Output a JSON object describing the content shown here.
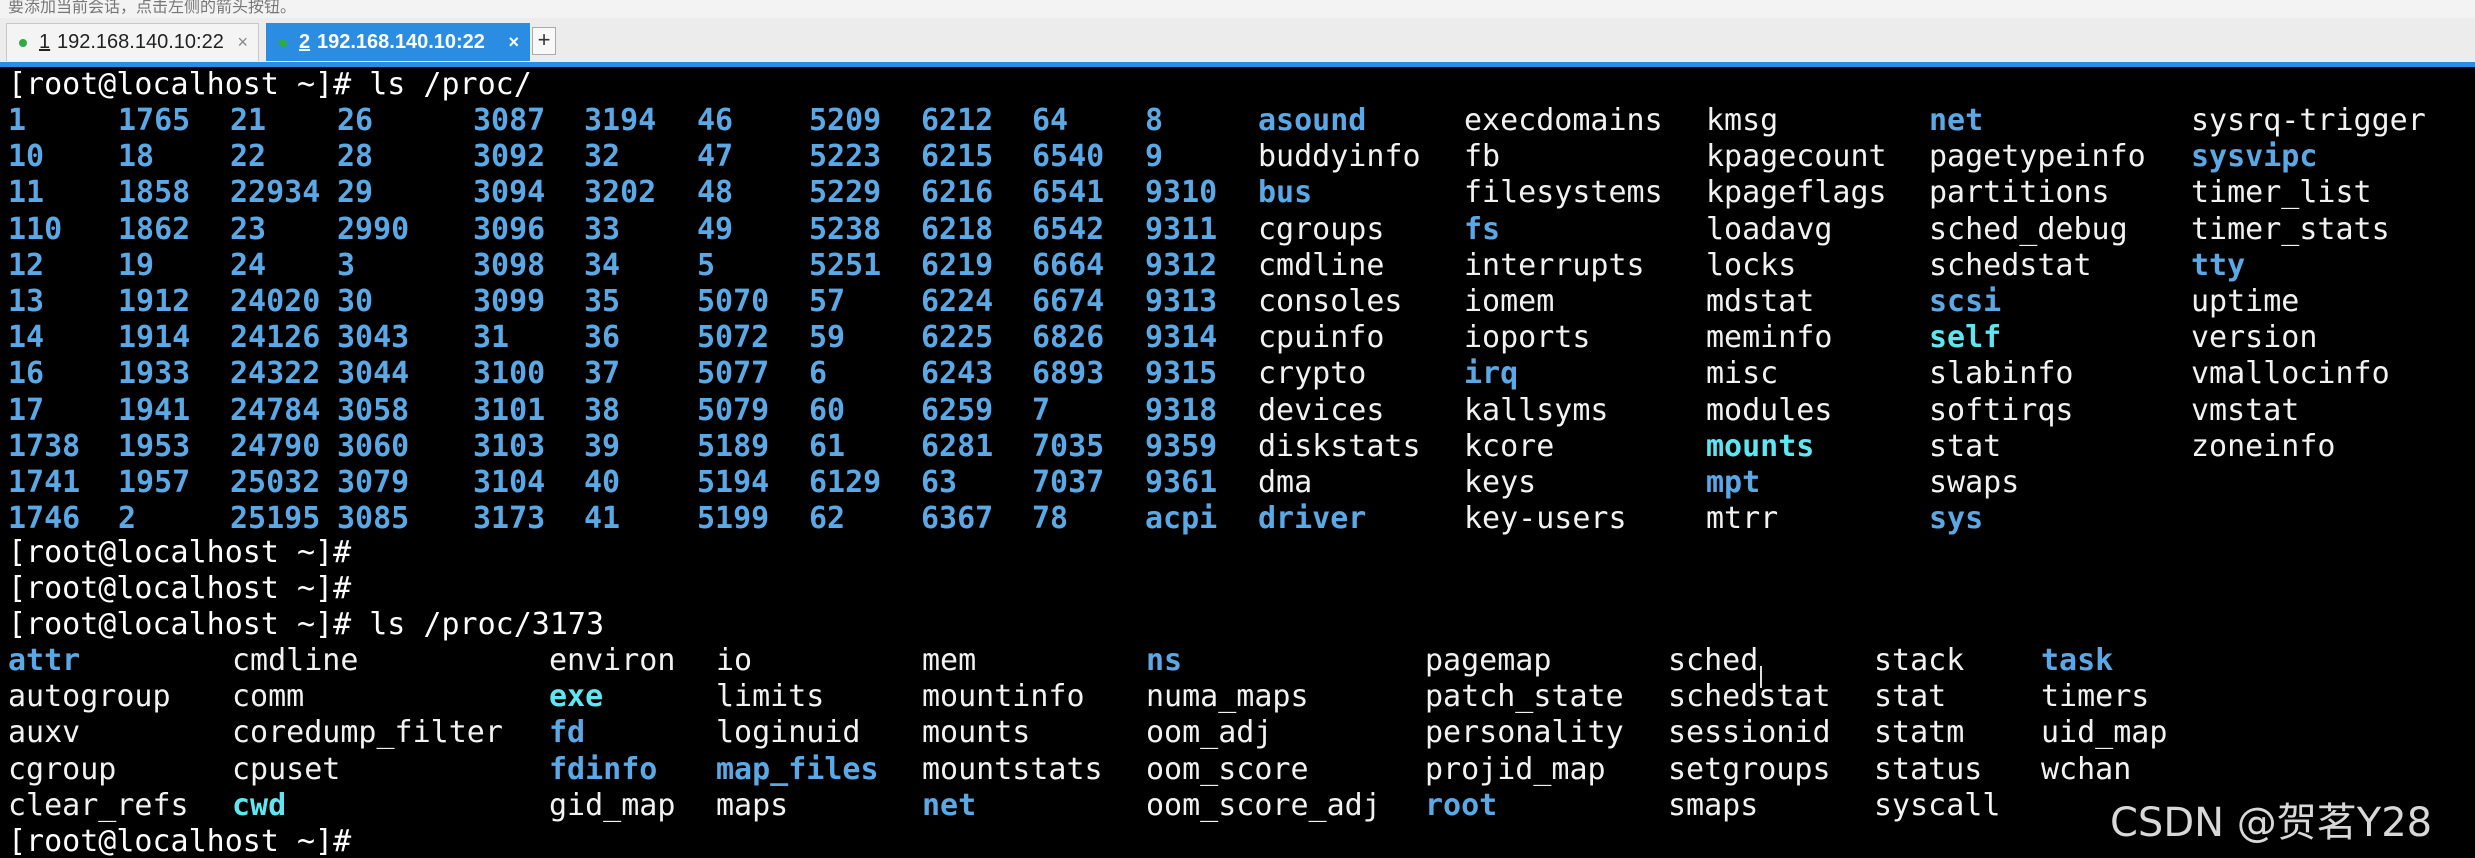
{
  "window": {
    "hint_text": "要添加当前会话，点击左侧的箭头按钮。",
    "tabs": [
      {
        "number": "1",
        "title": "192.168.140.10:22",
        "close": "×"
      },
      {
        "number": "2",
        "title": "192.168.140.10:22",
        "close": "×"
      }
    ],
    "add_tab": "+"
  },
  "terminal": {
    "prompt_lines": [
      "[root@localhost ~]# ls /proc/",
      "[root@localhost ~]#",
      "[root@localhost ~]#",
      "[root@localhost ~]# ls /proc/3173",
      "[root@localhost ~]#"
    ],
    "proc_listing": {
      "rows": [
        [
          "1",
          "1765",
          "21",
          "26",
          "3087",
          "3194",
          "46",
          "5209",
          "6212",
          "64",
          "8",
          "asound",
          "execdomains",
          "kmsg",
          "net",
          "sysrq-trigger"
        ],
        [
          "10",
          "18",
          "22",
          "28",
          "3092",
          "32",
          "47",
          "5223",
          "6215",
          "6540",
          "9",
          "buddyinfo",
          "fb",
          "kpagecount",
          "pagetypeinfo",
          "sysvipc"
        ],
        [
          "11",
          "1858",
          "22934",
          "29",
          "3094",
          "3202",
          "48",
          "5229",
          "6216",
          "6541",
          "9310",
          "bus",
          "filesystems",
          "kpageflags",
          "partitions",
          "timer_list"
        ],
        [
          "110",
          "1862",
          "23",
          "2990",
          "3096",
          "33",
          "49",
          "5238",
          "6218",
          "6542",
          "9311",
          "cgroups",
          "fs",
          "loadavg",
          "sched_debug",
          "timer_stats"
        ],
        [
          "12",
          "19",
          "24",
          "3",
          "3098",
          "34",
          "5",
          "5251",
          "6219",
          "6664",
          "9312",
          "cmdline",
          "interrupts",
          "locks",
          "schedstat",
          "tty"
        ],
        [
          "13",
          "1912",
          "24020",
          "30",
          "3099",
          "35",
          "5070",
          "57",
          "6224",
          "6674",
          "9313",
          "consoles",
          "iomem",
          "mdstat",
          "scsi",
          "uptime"
        ],
        [
          "14",
          "1914",
          "24126",
          "3043",
          "31",
          "36",
          "5072",
          "59",
          "6225",
          "6826",
          "9314",
          "cpuinfo",
          "ioports",
          "meminfo",
          "self",
          "version"
        ],
        [
          "16",
          "1933",
          "24322",
          "3044",
          "3100",
          "37",
          "5077",
          "6",
          "6243",
          "6893",
          "9315",
          "crypto",
          "irq",
          "misc",
          "slabinfo",
          "vmallocinfo"
        ],
        [
          "17",
          "1941",
          "24784",
          "3058",
          "3101",
          "38",
          "5079",
          "60",
          "6259",
          "7",
          "9318",
          "devices",
          "kallsyms",
          "modules",
          "softirqs",
          "vmstat"
        ],
        [
          "1738",
          "1953",
          "24790",
          "3060",
          "3103",
          "39",
          "5189",
          "61",
          "6281",
          "7035",
          "9359",
          "diskstats",
          "kcore",
          "mounts",
          "stat",
          "zoneinfo"
        ],
        [
          "1741",
          "1957",
          "25032",
          "3079",
          "3104",
          "40",
          "5194",
          "6129",
          "63",
          "7037",
          "9361",
          "dma",
          "keys",
          "mpt",
          "swaps",
          ""
        ],
        [
          "1746",
          "2",
          "25195",
          "3085",
          "3173",
          "41",
          "5199",
          "62",
          "6367",
          "78",
          "acpi",
          "driver",
          "key-users",
          "mtrr",
          "sys",
          ""
        ]
      ],
      "types": [
        [
          "n",
          "n",
          "n",
          "n",
          "n",
          "n",
          "n",
          "n",
          "n",
          "n",
          "n",
          "d",
          "r",
          "r",
          "d",
          "r"
        ],
        [
          "n",
          "n",
          "n",
          "n",
          "n",
          "n",
          "n",
          "n",
          "n",
          "n",
          "n",
          "r",
          "r",
          "r",
          "r",
          "d"
        ],
        [
          "n",
          "n",
          "n",
          "n",
          "n",
          "n",
          "n",
          "n",
          "n",
          "n",
          "n",
          "d",
          "r",
          "r",
          "r",
          "r"
        ],
        [
          "n",
          "n",
          "n",
          "n",
          "n",
          "n",
          "n",
          "n",
          "n",
          "n",
          "n",
          "r",
          "d",
          "r",
          "r",
          "r"
        ],
        [
          "n",
          "n",
          "n",
          "n",
          "n",
          "n",
          "n",
          "n",
          "n",
          "n",
          "n",
          "r",
          "r",
          "r",
          "r",
          "d"
        ],
        [
          "n",
          "n",
          "n",
          "n",
          "n",
          "n",
          "n",
          "n",
          "n",
          "n",
          "n",
          "r",
          "r",
          "r",
          "d",
          "r"
        ],
        [
          "n",
          "n",
          "n",
          "n",
          "n",
          "n",
          "n",
          "n",
          "n",
          "n",
          "n",
          "r",
          "r",
          "r",
          "c",
          "r"
        ],
        [
          "n",
          "n",
          "n",
          "n",
          "n",
          "n",
          "n",
          "n",
          "n",
          "n",
          "n",
          "r",
          "d",
          "r",
          "r",
          "r"
        ],
        [
          "n",
          "n",
          "n",
          "n",
          "n",
          "n",
          "n",
          "n",
          "n",
          "n",
          "n",
          "r",
          "r",
          "r",
          "r",
          "r"
        ],
        [
          "n",
          "n",
          "n",
          "n",
          "n",
          "n",
          "n",
          "n",
          "n",
          "n",
          "n",
          "r",
          "r",
          "c",
          "r",
          "r"
        ],
        [
          "n",
          "n",
          "n",
          "n",
          "n",
          "n",
          "n",
          "n",
          "n",
          "n",
          "n",
          "r",
          "r",
          "d",
          "r",
          "r"
        ],
        [
          "n",
          "n",
          "n",
          "n",
          "n",
          "n",
          "n",
          "n",
          "n",
          "n",
          "d",
          "d",
          "r",
          "r",
          "d",
          "r"
        ]
      ]
    },
    "pid_listing": {
      "rows": [
        [
          "attr",
          "cmdline",
          "environ",
          "io",
          "mem",
          "ns",
          "pagemap",
          "sched",
          "stack",
          "task"
        ],
        [
          "autogroup",
          "comm",
          "exe",
          "limits",
          "mountinfo",
          "numa_maps",
          "patch_state",
          "schedstat",
          "stat",
          "timers"
        ],
        [
          "auxv",
          "coredump_filter",
          "fd",
          "loginuid",
          "mounts",
          "oom_adj",
          "personality",
          "sessionid",
          "statm",
          "uid_map"
        ],
        [
          "cgroup",
          "cpuset",
          "fdinfo",
          "map_files",
          "mountstats",
          "oom_score",
          "projid_map",
          "setgroups",
          "status",
          "wchan"
        ],
        [
          "clear_refs",
          "cwd",
          "gid_map",
          "maps",
          "net",
          "oom_score_adj",
          "root",
          "smaps",
          "syscall",
          ""
        ]
      ],
      "types": [
        [
          "d",
          "r",
          "r",
          "r",
          "r",
          "d",
          "r",
          "r",
          "r",
          "d"
        ],
        [
          "r",
          "r",
          "c",
          "r",
          "r",
          "r",
          "r",
          "r",
          "r",
          "r"
        ],
        [
          "r",
          "r",
          "d",
          "r",
          "r",
          "r",
          "r",
          "r",
          "r",
          "r"
        ],
        [
          "r",
          "r",
          "d",
          "d",
          "r",
          "r",
          "r",
          "r",
          "r",
          "r"
        ],
        [
          "r",
          "c",
          "r",
          "r",
          "d",
          "r",
          "d",
          "r",
          "r",
          "r"
        ]
      ]
    }
  },
  "watermark": "CSDN @贺茗Y28",
  "colors": {
    "accent": "#2a8de1",
    "directory": "#5aa9e6",
    "symlink": "#5ee7f0",
    "text": "#f2f2f2",
    "background": "#000000"
  }
}
